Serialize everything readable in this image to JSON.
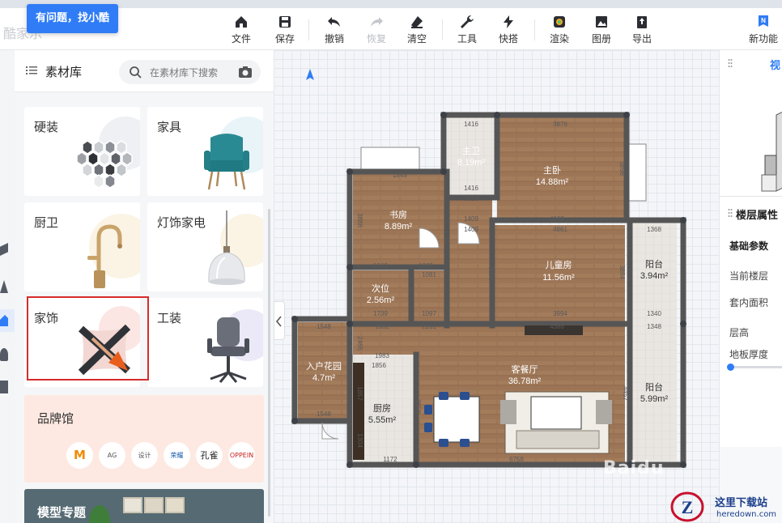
{
  "help_bubble": "有问题，找小酷",
  "logo_text": "酷家乐",
  "toolbar": {
    "file": "文件",
    "save": "保存",
    "undo": "撤销",
    "redo": "恢复",
    "clear": "清空",
    "tools": "工具",
    "quick": "快搭",
    "render": "渲染",
    "album": "图册",
    "export": "导出",
    "new_feature": "新功能"
  },
  "material_library": {
    "title": "素材库",
    "search_placeholder": "在素材库下搜索",
    "categories": [
      {
        "label": "硬装"
      },
      {
        "label": "家具"
      },
      {
        "label": "厨卫"
      },
      {
        "label": "灯饰家电"
      },
      {
        "label": "家饰",
        "highlighted": true
      },
      {
        "label": "工装"
      }
    ],
    "brand_hall": {
      "title": "品牌馆",
      "brands": [
        "M",
        "AG",
        "设计",
        "荣耀",
        "孔雀",
        "OPPEIN"
      ]
    },
    "model_topic": "模型专题"
  },
  "floorplan": {
    "rooms": [
      {
        "name": "主卫",
        "area": "8.19m²"
      },
      {
        "name": "主卧",
        "area": "14.88m²"
      },
      {
        "name": "书房",
        "area": "8.89m²"
      },
      {
        "name": "儿童房",
        "area": "11.56m²"
      },
      {
        "name": "阳台",
        "area": "3.94m²"
      },
      {
        "name": "次位",
        "area": "2.56m²"
      },
      {
        "name": "入户花园",
        "area": "4.7m²"
      },
      {
        "name": "客餐厅",
        "area": "36.78m²"
      },
      {
        "name": "厨房",
        "area": "5.55m²"
      },
      {
        "name": "阳台",
        "area": "5.99m²"
      }
    ],
    "dimensions": [
      "1416",
      "3876",
      "1849",
      "1416",
      "3616",
      "4162",
      "4861",
      "1409",
      "1409",
      "1368",
      "1963",
      "1089",
      "1081",
      "1739",
      "1097",
      "3994",
      "4388",
      "1340",
      "1348",
      "1548",
      "1882",
      "2261",
      "1983",
      "1856",
      "1548",
      "1172",
      "6758",
      "3886",
      "3898",
      "3650",
      "4457",
      "1304",
      "1857",
      "2466",
      "3896",
      "3884"
    ]
  },
  "right_panel": {
    "view_tab": "视",
    "floor_props_title": "楼层属性",
    "basic_params": "基础参数",
    "current_floor": "当前楼层",
    "inner_area": "套内面积",
    "floor_height": "层高",
    "floor_thickness": "地板厚度"
  },
  "watermark": {
    "name": "这里下载站",
    "url": "heredown.com",
    "baidu": "Baidu"
  }
}
